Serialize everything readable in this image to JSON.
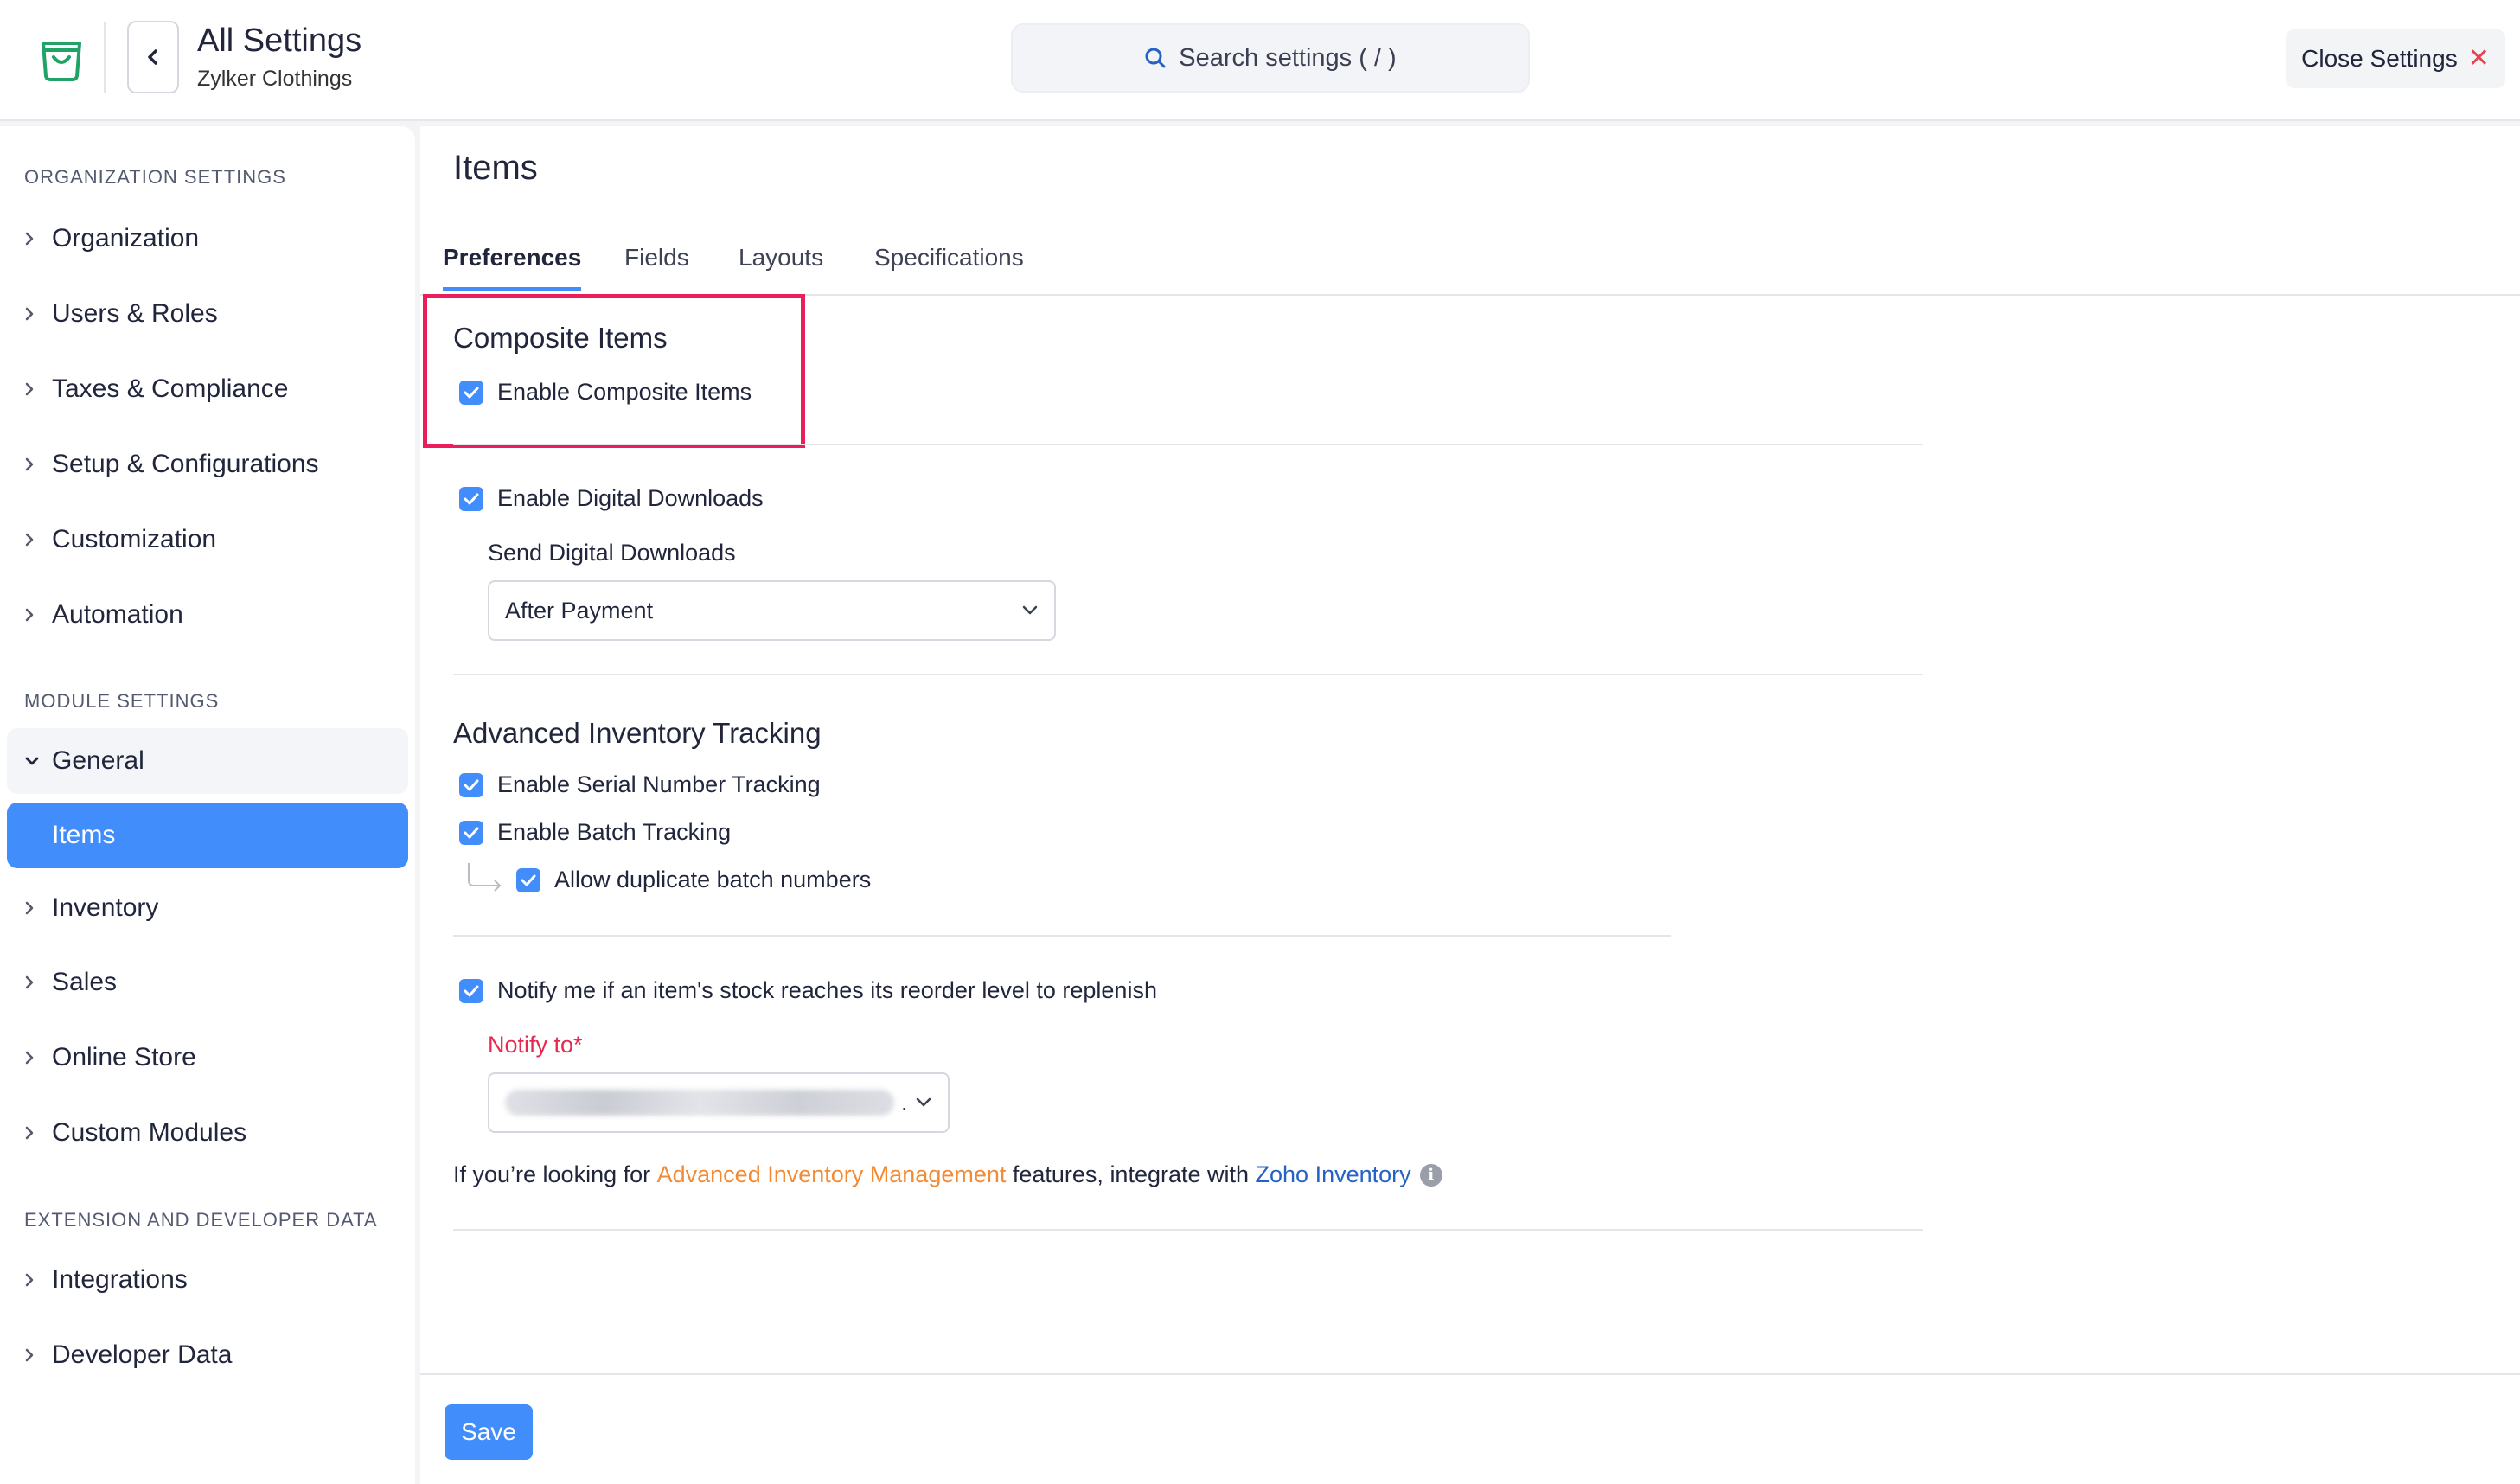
{
  "header": {
    "title": "All Settings",
    "subtitle": "Zylker Clothings",
    "search_placeholder": "Search settings ( / )",
    "close_label": "Close Settings",
    "colors": {
      "brand": "#21a366",
      "close_x": "#e8414f"
    }
  },
  "sidebar": {
    "org_heading": "ORGANIZATION SETTINGS",
    "org_items": [
      "Organization",
      "Users & Roles",
      "Taxes & Compliance",
      "Setup & Configurations",
      "Customization",
      "Automation"
    ],
    "module_heading": "MODULE SETTINGS",
    "general_label": "General",
    "active_item": "Items",
    "module_items": [
      "Inventory",
      "Sales",
      "Online Store",
      "Custom Modules"
    ],
    "ext_heading": "EXTENSION AND DEVELOPER DATA",
    "ext_items": [
      "Integrations",
      "Developer Data"
    ],
    "accent": "#408dfb"
  },
  "main": {
    "title": "Items",
    "tabs": [
      "Preferences",
      "Fields",
      "Layouts",
      "Specifications"
    ],
    "active_tab": "Preferences",
    "composite": {
      "title": "Composite Items",
      "enable_label": "Enable Composite Items",
      "enabled": true
    },
    "digital": {
      "enable_label": "Enable Digital Downloads",
      "enabled": true,
      "send_label": "Send Digital Downloads",
      "send_value": "After Payment"
    },
    "tracking": {
      "title": "Advanced Inventory Tracking",
      "serial_label": "Enable Serial Number Tracking",
      "batch_label": "Enable Batch Tracking",
      "duplicate_label": "Allow duplicate batch numbers",
      "serial_enabled": true,
      "batch_enabled": true,
      "duplicate_enabled": true
    },
    "notify": {
      "label": "Notify me if an item's stock reaches its reorder level to replenish",
      "enabled": true,
      "to_label": "Notify to*",
      "to_suffix": "."
    },
    "info": {
      "prefix": "If you’re looking for ",
      "link1": "Advanced Inventory Management",
      "middle": " features, integrate with ",
      "link2": "Zoho Inventory",
      "icon": "info-icon"
    },
    "highlight_color": "#ea1e5b"
  },
  "footer": {
    "save_label": "Save"
  }
}
